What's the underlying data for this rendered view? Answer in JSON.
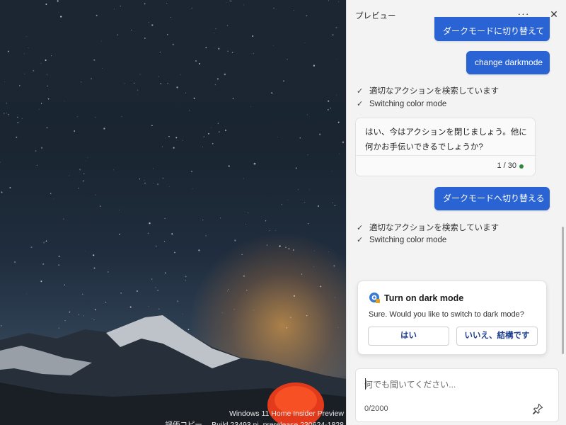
{
  "desktop": {
    "watermark_line1": "Windows 11 Home Insider Preview",
    "watermark_line2": "評価コピー。 Build 23493.ni_prerelease.230624-1828"
  },
  "pane": {
    "title": "プレビュー",
    "more_label": "···",
    "close_label": "✕"
  },
  "conversation": {
    "user_msg_top": "ダークモードに切り替えて",
    "user_msg_change": "change darkmode",
    "status_1a": "適切なアクションを検索しています",
    "status_1b": "Switching color mode",
    "bot_reply": "はい、今はアクションを閉じましょう。他に何かお手伝いできるでしょうか?",
    "bot_counter": "1 / 30",
    "user_msg_dark": "ダークモードへ切り替える",
    "status_2a": "適切なアクションを検索しています",
    "status_2b": "Switching color mode"
  },
  "action_card": {
    "title": "Turn on dark mode",
    "description": "Sure. Would you like to switch to dark mode?",
    "yes_label": "はい",
    "no_label": "いいえ、結構です",
    "icon": "settings-app-icon"
  },
  "composer": {
    "placeholder": "何でも聞いてください...",
    "value": "",
    "char_count": "0/2000",
    "pin_icon": "pin-icon"
  },
  "colors": {
    "user_bubble": "#2a63d4",
    "pane_bg": "#f3f3f3",
    "status_dot": "#2b8a3e"
  }
}
